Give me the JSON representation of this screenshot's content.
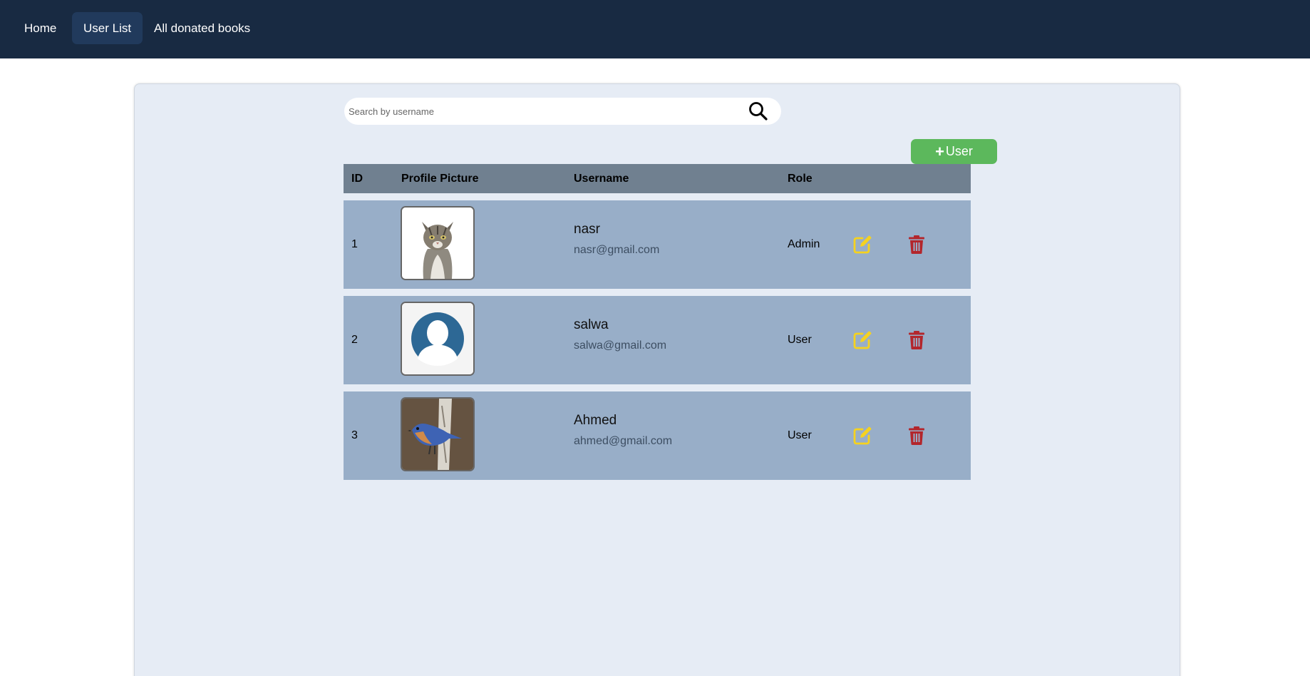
{
  "nav": {
    "items": [
      {
        "label": "Home"
      },
      {
        "label": "User List"
      },
      {
        "label": "All donated books"
      }
    ]
  },
  "search": {
    "placeholder": "Search by username",
    "value": "",
    "icon": "search-icon"
  },
  "add_button": {
    "icon": "plus-icon",
    "label": "User",
    "color": "#5cb85c"
  },
  "table": {
    "headers": [
      "ID",
      "Profile Picture",
      "Username",
      "Role"
    ],
    "rows": [
      {
        "id": "1",
        "picture": "cat-photo",
        "username": "nasr",
        "email": "nasr@gmail.com",
        "role": "Admin"
      },
      {
        "id": "2",
        "picture": "default-avatar",
        "username": "salwa",
        "email": "salwa@gmail.com",
        "role": "User"
      },
      {
        "id": "3",
        "picture": "bluebird-photo",
        "username": "Ahmed",
        "email": "ahmed@gmail.com",
        "role": "User"
      }
    ]
  },
  "colors": {
    "navbar": "#182a42",
    "nav_active": "#213a5c",
    "panel": "#e6ecf5",
    "table_header": "#708090",
    "row": "#98aec8",
    "edit_icon": "#f5d21f",
    "delete_icon": "#b3262c"
  }
}
